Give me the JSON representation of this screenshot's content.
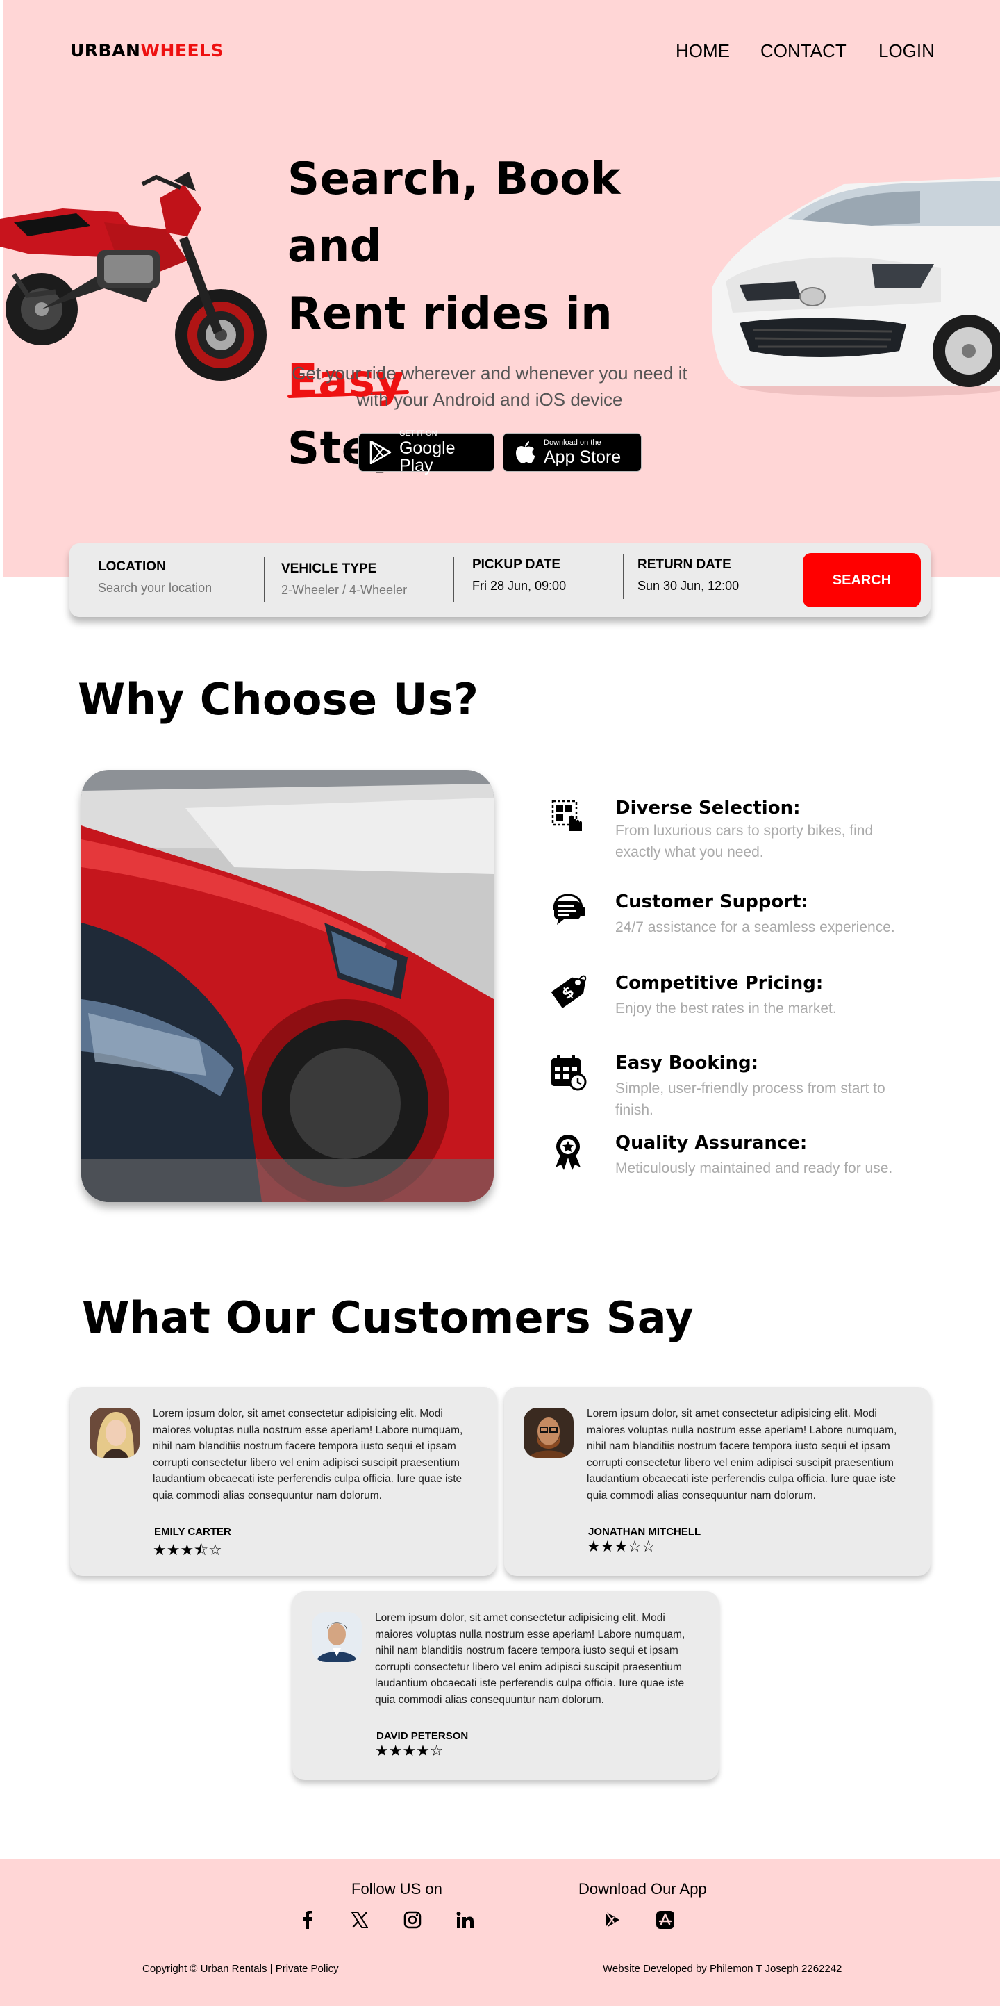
{
  "brand": {
    "part1": "URBAN",
    "part2": "WHEELS",
    "accent_color": "#ee1111"
  },
  "nav": {
    "home": "HOME",
    "contact": "CONTACT",
    "login": "LOGIN"
  },
  "hero": {
    "title_line1": "Search, Book and",
    "title_line2_prefix": "Rent rides in ",
    "title_line2_accent": "Easy",
    "title_line3": "Steps",
    "subtitle": "Get your ride wherever and whenever you need it with your Android and iOS device",
    "google_play": {
      "small": "GET IT ON",
      "big": "Google Play"
    },
    "app_store": {
      "small": "Download on the",
      "big": "App Store"
    },
    "background": "#ffd6d6"
  },
  "search": {
    "location": {
      "label": "LOCATION",
      "placeholder": "Search your location"
    },
    "vehicle": {
      "label": "VEHICLE TYPE",
      "placeholder": "2-Wheeler / 4-Wheeler"
    },
    "pickup": {
      "label": "PICKUP DATE",
      "value": "Fri 28 Jun, 09:00"
    },
    "return": {
      "label": "RETURN DATE",
      "value": "Sun 30 Jun, 12:00"
    },
    "button": "SEARCH",
    "button_color": "#ff0000"
  },
  "why": {
    "heading": "Why Choose Us?",
    "features": [
      {
        "icon": "grid-select-icon",
        "title": "Diverse Selection:",
        "desc": "From luxurious cars to sporty bikes, find exactly what you need."
      },
      {
        "icon": "support-chat-icon",
        "title": "Customer Support:",
        "desc": "24/7 assistance for a seamless experience."
      },
      {
        "icon": "price-tag-icon",
        "title": "Competitive Pricing:",
        "desc": "Enjoy the best rates in the market."
      },
      {
        "icon": "calendar-clock-icon",
        "title": "Easy Booking:",
        "desc": "Simple, user-friendly process from start to finish."
      },
      {
        "icon": "award-badge-icon",
        "title": "Quality Assurance:",
        "desc": "Meticulously maintained and ready for use."
      }
    ]
  },
  "testimonials": {
    "heading": "What Our Customers Say",
    "items": [
      {
        "name": "EMILY CARTER",
        "rating": 3.5,
        "stars": "★★★⯪☆",
        "quote": "Lorem ipsum dolor, sit amet consectetur adipisicing elit. Modi maiores voluptas nulla nostrum esse aperiam! Labore numquam, nihil nam blanditiis nostrum facere tempora iusto sequi et ipsam corrupti consectetur libero vel enim adipisci suscipit praesentium laudantium obcaecati iste perferendis culpa officia. Iure quae iste quia commodi alias consequuntur nam dolorum."
      },
      {
        "name": "JONATHAN MITCHELL",
        "rating": 3,
        "stars": "★★★☆☆",
        "quote": "Lorem ipsum dolor, sit amet consectetur adipisicing elit. Modi maiores voluptas nulla nostrum esse aperiam! Labore numquam, nihil nam blanditiis nostrum facere tempora iusto sequi et ipsam corrupti consectetur libero vel enim adipisci suscipit praesentium laudantium obcaecati iste perferendis culpa officia. Iure quae iste quia commodi alias consequuntur nam dolorum."
      },
      {
        "name": "DAVID PETERSON",
        "rating": 4,
        "stars": "★★★★☆",
        "quote": "Lorem ipsum dolor, sit amet consectetur adipisicing elit. Modi maiores voluptas nulla nostrum esse aperiam! Labore numquam, nihil nam blanditiis nostrum facere tempora iusto sequi et ipsam corrupti consectetur libero vel enim adipisci suscipit praesentium laudantium obcaecati iste perferendis culpa officia. Iure quae iste quia commodi alias consequuntur nam dolorum."
      }
    ]
  },
  "footer": {
    "follow": "Follow US on",
    "download": "Download Our App",
    "social_icons": [
      "facebook-icon",
      "x-twitter-icon",
      "instagram-icon",
      "linkedin-icon"
    ],
    "app_icons": [
      "google-play-icon",
      "app-store-icon"
    ],
    "copyright": "Copyright © Urban Rentals",
    "privacy": "Private Policy",
    "credit": "Website Developed by Philemon T Joseph 2262242"
  }
}
